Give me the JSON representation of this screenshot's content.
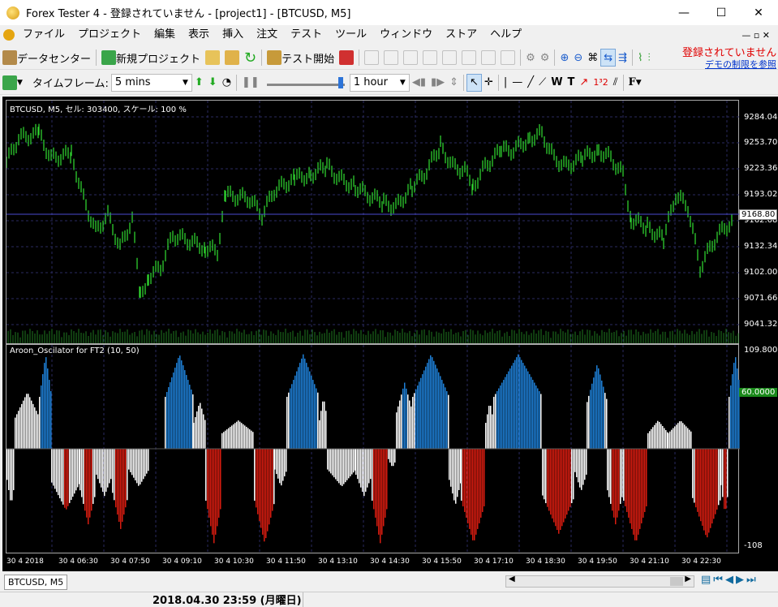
{
  "window": {
    "title": "Forex Tester 4 - 登録されていません - [project1] - [BTCUSD, M5]"
  },
  "menu": [
    "ファイル",
    "プロジェクト",
    "編集",
    "表示",
    "挿入",
    "注文",
    "テスト",
    "ツール",
    "ウィンドウ",
    "ストア",
    "ヘルプ"
  ],
  "toolbar1": {
    "data_center": "データセンター",
    "new_project": "新規プロジェクト",
    "start_test": "テスト開始",
    "unregistered": "登録されていません",
    "demo_link": "デモの制限を参照"
  },
  "toolbar2": {
    "timeframe_label": "タイムフレーム:",
    "timeframe_value": "5 mins",
    "step_value": "1 hour",
    "font_label": "F"
  },
  "chart": {
    "price_title": "BTCUSD, M5, セル: 303400, スケール: 100 %",
    "price_axis": [
      "9284.040",
      "9253.700",
      "9223.360",
      "9193.020",
      "9162.680",
      "9132.340",
      "9102.000",
      "9071.660",
      "9041.320"
    ],
    "current_price": "9168.80",
    "indicator_title": "Aroon_Oscilator for FT2 (10, 50)",
    "indicator_axis_top": "109.8000",
    "indicator_axis_bottom": "-108",
    "indicator_level": "60.0000",
    "x_labels": [
      "30 4 2018",
      "30 4 06:30",
      "30 4 07:50",
      "30 4 09:10",
      "30 4 10:30",
      "30 4 11:50",
      "30 4 13:10",
      "30 4 14:30",
      "30 4 15:50",
      "30 4 17:10",
      "30 4 18:30",
      "30 4 19:50",
      "30 4 21:10",
      "30 4 22:30"
    ],
    "colors": {
      "up": "#00ff00",
      "bull": "#1e7fd6",
      "bear": "#d81c10",
      "neutral": "#ffffff",
      "bg": "#000000"
    }
  },
  "statusbar": {
    "tab": "BTCUSD, M5",
    "datetime": "2018.04.30 23:59 (月曜日)"
  }
}
